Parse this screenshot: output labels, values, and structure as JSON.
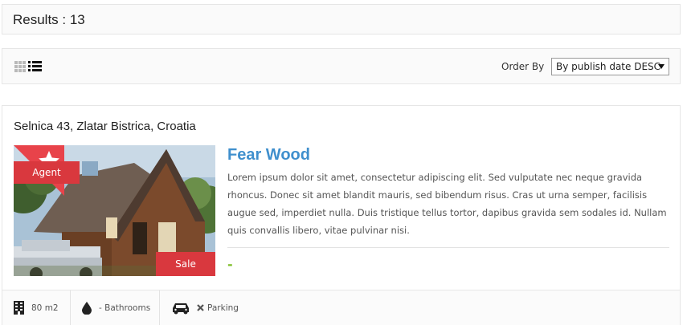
{
  "results": {
    "label": "Results : 13"
  },
  "toolbar": {
    "order_label": "Order By",
    "order_value": "By publish date DESC",
    "views": [
      "grid-view-icon",
      "list-view-icon"
    ]
  },
  "listing": {
    "address": "Selnica 43, Zlatar Bistrica, Croatia",
    "title": "Fear Wood",
    "description": "Lorem ipsum dolor sit amet, consectetur adipiscing elit. Sed vulputate nec neque gravida rhoncus. Donec sit amet blandit mauris, sed bibendum risus. Cras ut urna semper, facilisis augue sed, imperdiet nulla. Duis tristique tellus tortor, dapibus gravida sem sodales id. Nullam quis convallis libero, vitae pulvinar nisi.",
    "badge_agent": "Agent",
    "badge_sale": "Sale",
    "price": "-",
    "featured_icon": "star-icon",
    "features": {
      "area": "80 m2",
      "bathrooms": "- Bathrooms",
      "parking": "Parking"
    }
  },
  "colors": {
    "accent_blue": "#3f8fcd",
    "badge_red": "#d9383e",
    "price_green": "#7fbf2a"
  }
}
